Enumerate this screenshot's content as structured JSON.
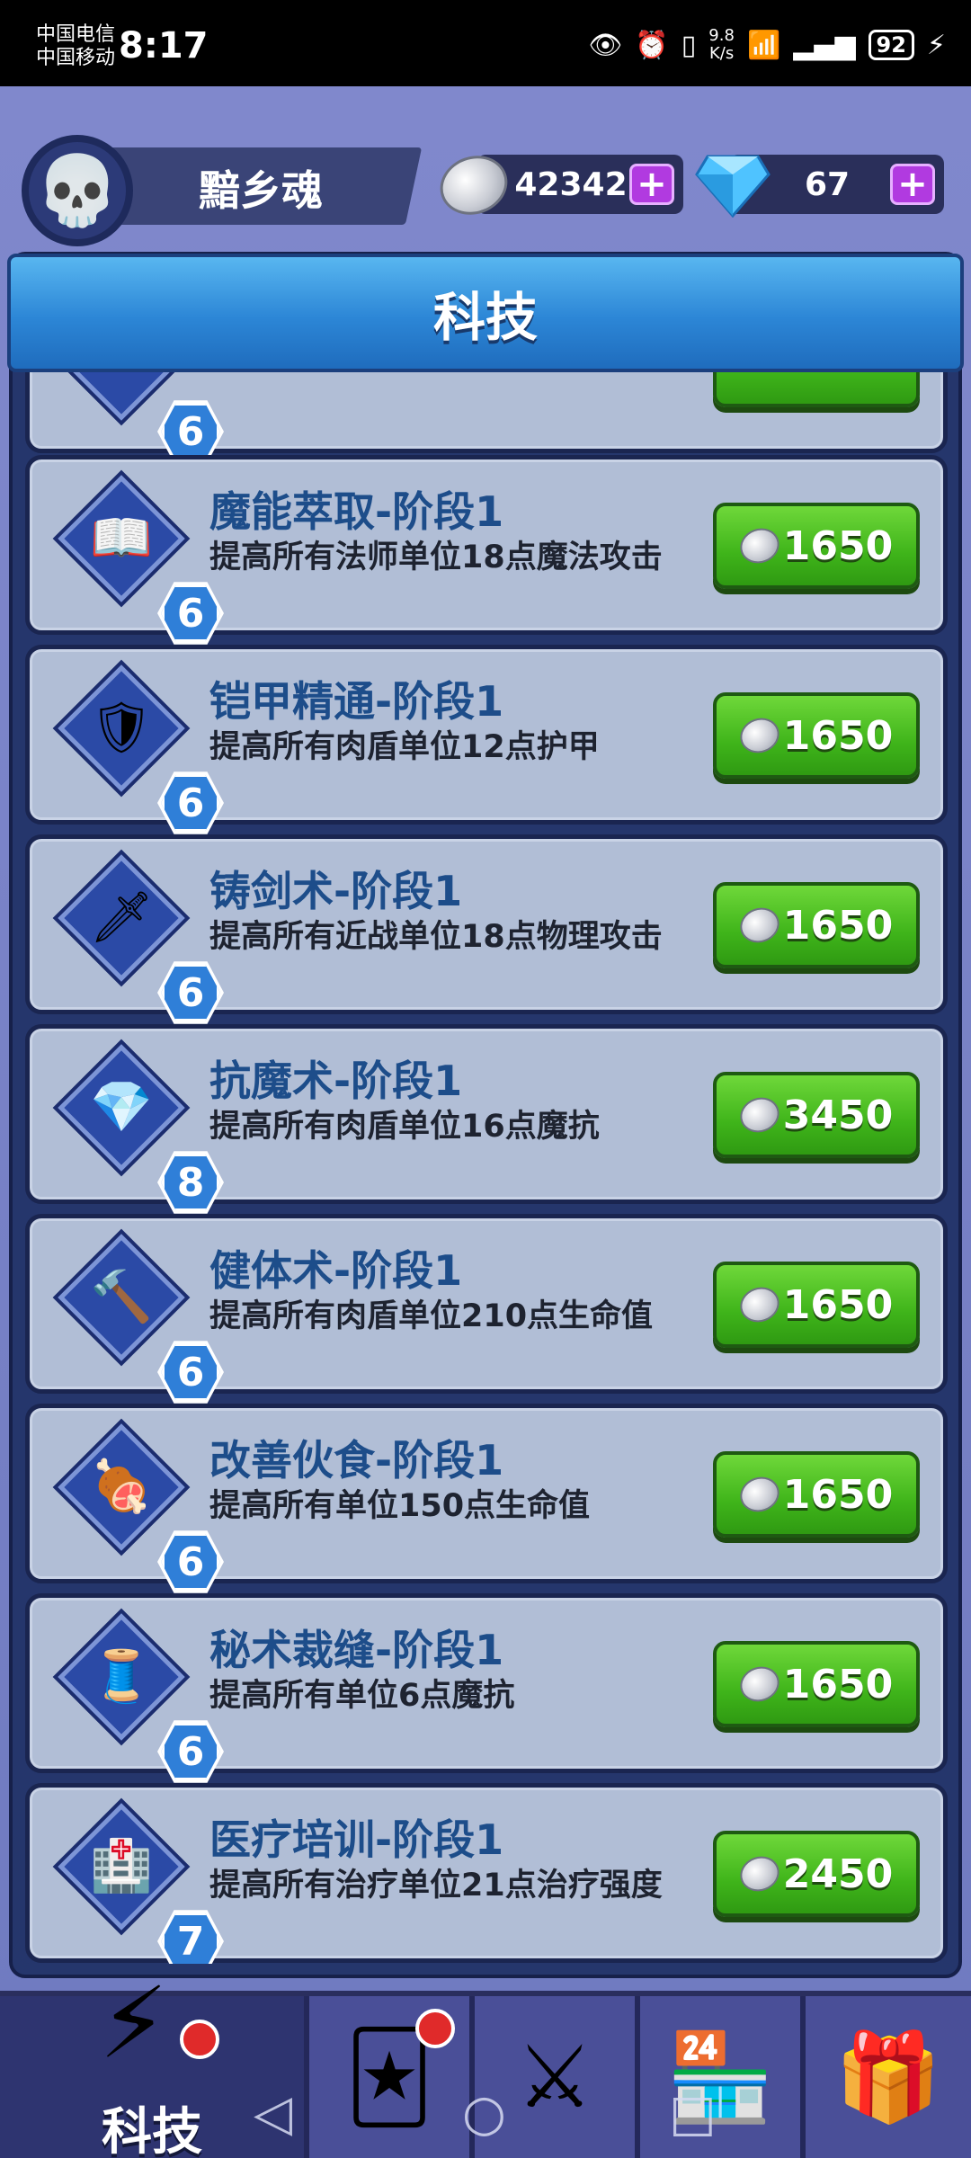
{
  "status_bar": {
    "carrier1": "中国电信",
    "carrier2": "中国移动",
    "time": "8:17",
    "net_speed_value": "9.8",
    "net_speed_unit": "K/s",
    "battery": "92"
  },
  "header": {
    "player_name": "黯乡魂",
    "silver": "42342",
    "gems": "67",
    "plus": "+"
  },
  "panel": {
    "title": "科技"
  },
  "partial_top_card": {
    "level": "6"
  },
  "techs": [
    {
      "name": "魔能萃取-阶段1",
      "desc": "提高所有法师单位18点魔法攻击",
      "level": "6",
      "cost": "1650",
      "icon": "magic-book-icon"
    },
    {
      "name": "铠甲精通-阶段1",
      "desc": "提高所有肉盾单位12点护甲",
      "level": "6",
      "cost": "1650",
      "icon": "armor-icon"
    },
    {
      "name": "铸剑术-阶段1",
      "desc": "提高所有近战单位18点物理攻击",
      "level": "6",
      "cost": "1650",
      "icon": "anvil-sword-icon"
    },
    {
      "name": "抗魔术-阶段1",
      "desc": "提高所有肉盾单位16点魔抗",
      "level": "8",
      "cost": "3450",
      "icon": "magic-shield-icon"
    },
    {
      "name": "健体术-阶段1",
      "desc": "提高所有肉盾单位210点生命值",
      "level": "6",
      "cost": "1650",
      "icon": "hammer-icon"
    },
    {
      "name": "改善伙食-阶段1",
      "desc": "提高所有单位150点生命值",
      "level": "6",
      "cost": "1650",
      "icon": "meat-icon"
    },
    {
      "name": "秘术裁缝-阶段1",
      "desc": "提高所有单位6点魔抗",
      "level": "6",
      "cost": "1650",
      "icon": "sewing-icon"
    },
    {
      "name": "医疗培训-阶段1",
      "desc": "提高所有治疗单位21点治疗强度",
      "level": "7",
      "cost": "2450",
      "icon": "hospital-icon"
    }
  ],
  "bottom_nav": {
    "active_label": "科技",
    "items": [
      "tech-icon",
      "cards-icon",
      "battle-icon",
      "shop-icon",
      "gift-icon"
    ]
  }
}
